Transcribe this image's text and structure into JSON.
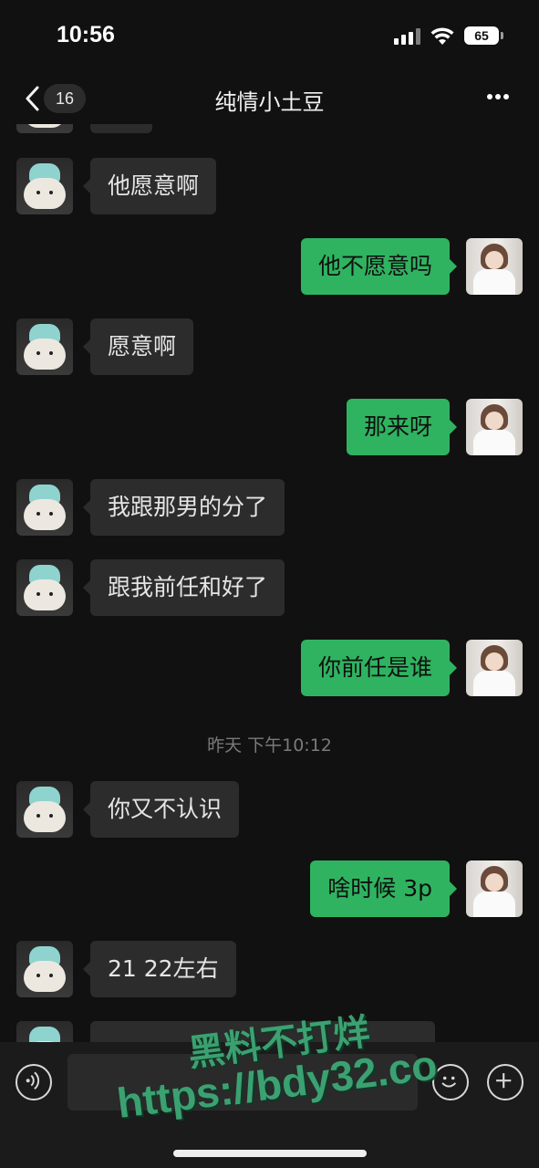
{
  "status_bar": {
    "time": "10:56",
    "battery": "65"
  },
  "nav": {
    "back_count": "16",
    "title": "纯情小土豆"
  },
  "messages": [
    {
      "side": "in",
      "text": "他愿意啊"
    },
    {
      "side": "out",
      "text": "他不愿意吗"
    },
    {
      "side": "in",
      "text": "愿意啊"
    },
    {
      "side": "out",
      "text": "那来呀"
    },
    {
      "side": "in",
      "text": "我跟那男的分了"
    },
    {
      "side": "in",
      "text": "跟我前任和好了"
    },
    {
      "side": "out",
      "text": "你前任是谁"
    },
    {
      "side": "in",
      "text": "你又不认识"
    },
    {
      "side": "out",
      "text": "啥时候 3p"
    },
    {
      "side": "in",
      "text": "21 22左右"
    }
  ],
  "timestamp": "昨天 下午10:12",
  "watermark": {
    "line1": "黑料不打烊",
    "line2": "https://bdy32.co"
  },
  "colors": {
    "background": "#111111",
    "incoming_bubble": "#2c2c2c",
    "outgoing_bubble": "#2fb360"
  }
}
